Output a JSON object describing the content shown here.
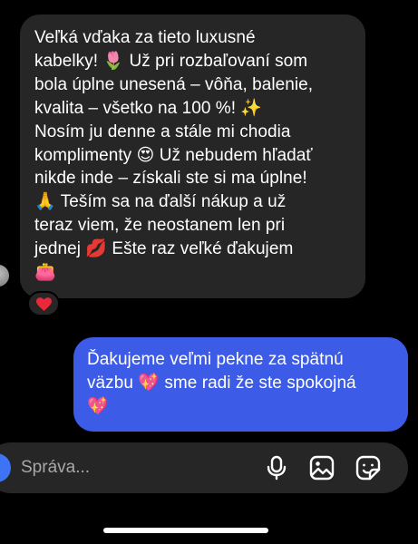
{
  "incoming_message": {
    "lines": [
      "Veľká vďaka za tieto luxusné",
      "kabelky! 🌷 Už pri rozbaľovaní som",
      "bola úplne unesená – vôňa, balenie,",
      "kvalita – všetko na 100 %! ✨",
      "Nosím ju denne a stále mi chodia",
      "komplimenty 😍 Už nebudem hľadať",
      "nikde inde – získali ste si ma úplne!",
      "🙏 Teším sa na ďalší nákup a už",
      "teraz viem, že neostanem len pri",
      "jednej 💋 Ešte raz veľké ďakujem",
      "👛"
    ],
    "reaction": "heart-icon"
  },
  "outgoing_message": {
    "lines": [
      "Ďakujeme veľmi pekne za spätnú",
      "väzbu 💖  sme radi že ste spokojná",
      "💖"
    ]
  },
  "composer": {
    "placeholder": "Správa...",
    "icons": [
      "microphone-icon",
      "image-icon",
      "sticker-icon"
    ]
  },
  "colors": {
    "background": "#000000",
    "incoming_bubble": "#262626",
    "outgoing_bubble": "#3c5ce8",
    "reaction_heart": "#e8283b",
    "placeholder_text": "#a8a8a8"
  }
}
